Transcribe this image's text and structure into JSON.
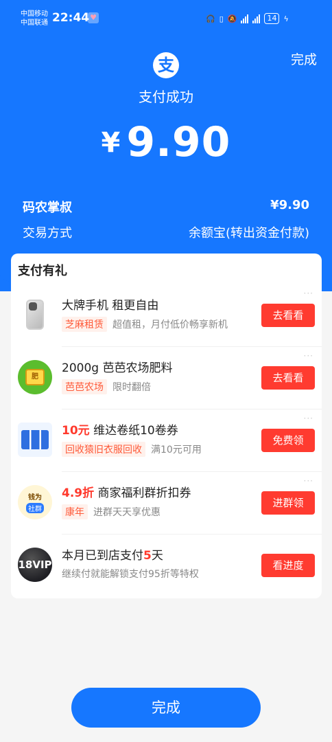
{
  "status_bar": {
    "carrier1": "中国移动",
    "carrier2": "中国联通",
    "time": "22:44",
    "battery": "14"
  },
  "header": {
    "done_label": "完成",
    "logo_char": "支",
    "title": "支付成功",
    "currency": "¥",
    "amount": "9.90"
  },
  "info": {
    "merchant": "码农掌叔",
    "merchant_amount": "¥9.90",
    "method_label": "交易方式",
    "method_value": "余额宝(转出资金付款)"
  },
  "gifts": {
    "title": "支付有礼",
    "items": [
      {
        "title": "大牌手机 租更自由",
        "tag": "芝麻租赁",
        "desc": "超值租，月付低价畅享新机",
        "button": "去看看",
        "icon": "phone-icon"
      },
      {
        "title": "2000g 芭芭农场肥料",
        "tag": "芭芭农场",
        "desc": "限时翻倍",
        "button": "去看看",
        "icon": "fertilizer-icon"
      },
      {
        "title_highlight": "10元",
        "title": "维达卷纸10卷券",
        "tag": "回收猿旧衣服回收",
        "desc": "满10元可用",
        "button": "免费领",
        "icon": "tissue-icon"
      },
      {
        "title_highlight": "4.9折",
        "title": "商家福利群折扣券",
        "tag": "康年",
        "desc": "进群天天享优惠",
        "button": "进群领",
        "icon": "group-icon",
        "icon_text1": "钱为",
        "icon_text2": "社群"
      },
      {
        "title_prefix": "本月已到店支付",
        "title_highlight": "5",
        "title_suffix": "天",
        "desc": "继续付就能解锁支付95折等特权",
        "button": "看进度",
        "icon": "vip-icon",
        "icon_text": "18VIP"
      }
    ]
  },
  "footer": {
    "done_label": "完成"
  },
  "colors": {
    "primary": "#1677ff",
    "action": "#ff3b30",
    "highlight": "#ff3a2d"
  }
}
